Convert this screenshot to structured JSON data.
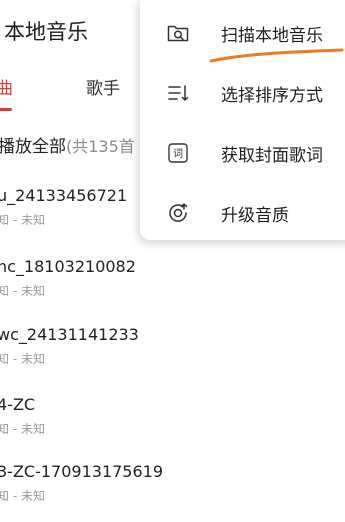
{
  "header": {
    "title": "本地音乐"
  },
  "tabs": [
    {
      "label": "曲",
      "active": true
    },
    {
      "label": "歌手",
      "active": false
    }
  ],
  "play_all": {
    "label": "播放全部",
    "count": "(共135首"
  },
  "songs": [
    {
      "name": "u_24133456721",
      "sub": "知 - 未知"
    },
    {
      "name": "nc_18103210082",
      "sub": "知 - 未知"
    },
    {
      "name": "wc_24131141233",
      "sub": "知 - 未知"
    },
    {
      "name": "4-ZC",
      "sub": "知 - 未知"
    },
    {
      "name": "3-ZC-170913175619",
      "sub": "知 - 未知"
    }
  ],
  "menu": {
    "items": [
      {
        "label": "扫描本地音乐",
        "icon": "folder-search-icon"
      },
      {
        "label": "选择排序方式",
        "icon": "sort-icon"
      },
      {
        "label": "获取封面歌词",
        "icon": "lyrics-icon"
      },
      {
        "label": "升级音质",
        "icon": "sound-quality-icon"
      }
    ]
  },
  "colors": {
    "accent": "#e23a2e",
    "annotation": "#f07a1a"
  }
}
